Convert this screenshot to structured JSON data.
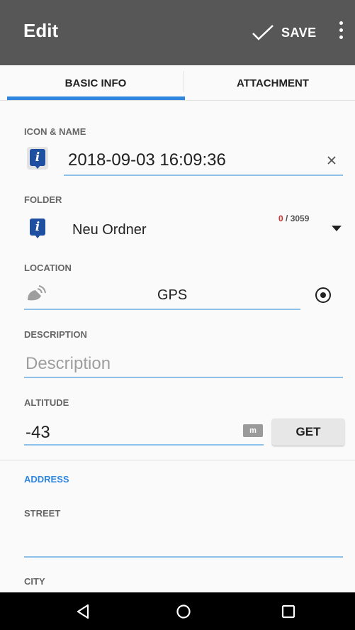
{
  "appbar": {
    "title": "Edit",
    "save_label": "SAVE",
    "bg_color": "#575757"
  },
  "tabs": [
    {
      "label": "BASIC INFO",
      "active": true
    },
    {
      "label": "ATTACHMENT",
      "active": false
    }
  ],
  "accent_color": "#2e86de",
  "icon_name": {
    "label": "ICON & NAME",
    "value": "2018-09-03 16:09:36",
    "icon": "info-marker-icon"
  },
  "folder": {
    "label": "FOLDER",
    "value": "Neu Ordner",
    "count_current": "0",
    "count_total": "/ 3059",
    "icon": "info-marker-icon"
  },
  "location": {
    "label": "LOCATION",
    "value": "GPS",
    "icon": "satellite-icon",
    "action_icon": "target-icon"
  },
  "description": {
    "label": "DESCRIPTION",
    "placeholder": "Description",
    "value": ""
  },
  "altitude": {
    "label": "ALTITUDE",
    "value": "-43",
    "unit": "m",
    "get_label": "GET"
  },
  "address": {
    "section_label": "ADDRESS",
    "street_label": "STREET",
    "street_value": "",
    "city_label": "CITY"
  },
  "navbar": {
    "icons": [
      "back-icon",
      "home-icon",
      "recent-apps-icon"
    ]
  }
}
